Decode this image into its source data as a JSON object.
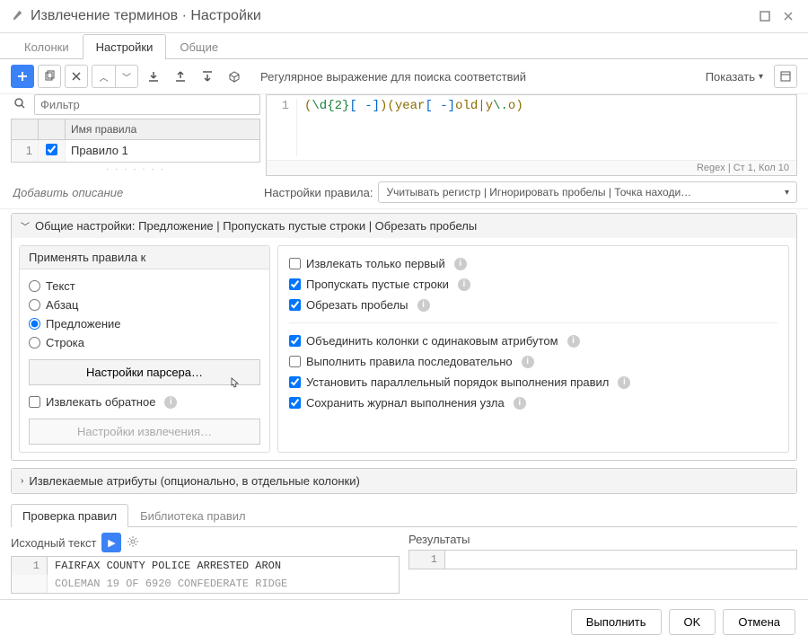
{
  "window": {
    "title": "Извлечение терминов · Настройки"
  },
  "tabs": {
    "columns": "Колонки",
    "settings": "Настройки",
    "general": "Общие"
  },
  "toolbar": {
    "regex_label": "Регулярное выражение для поиска соответствий",
    "show_label": "Показать"
  },
  "filter": {
    "placeholder": "Фильтр"
  },
  "rules_table": {
    "header_name": "Имя правила",
    "rows": [
      {
        "num": "1",
        "checked": true,
        "name": "Правило 1"
      }
    ]
  },
  "code": {
    "line_num": "1",
    "regex_display": "(\\d{2}[ -])(year[ -]old|y\\.o)",
    "status": "Regex | Ст 1, Кол 10"
  },
  "desc": {
    "placeholder": "Добавить описание",
    "rule_settings_label": "Настройки правила:",
    "rule_settings_items": "Учитывать регистр | Игнорировать пробелы | Точка находи…"
  },
  "general_settings": {
    "header": "Общие настройки: Предложение | Пропускать пустые строки | Обрезать пробелы",
    "apply_to_label": "Применять правила к",
    "radios": {
      "text": "Текст",
      "paragraph": "Абзац",
      "sentence": "Предложение",
      "line": "Строка"
    },
    "parser_btn": "Настройки парсера…",
    "extract_inverse": "Извлекать обратное",
    "extract_settings_btn": "Настройки извлечения…",
    "checks": {
      "first_only": "Извлекать только первый",
      "skip_empty": "Пропускать пустые строки",
      "trim": "Обрезать пробелы",
      "merge_cols": "Объединить колонки с одинаковым атрибутом",
      "sequential": "Выполнить правила последовательно",
      "parallel": "Установить параллельный порядок выполнения правил",
      "save_log": "Сохранить журнал выполнения узла"
    }
  },
  "extracted_attrs": {
    "header": "Извлекаемые атрибуты (опционально, в отдельные колонки)"
  },
  "bottom_tabs": {
    "check": "Проверка правил",
    "library": "Библиотека правил"
  },
  "preview": {
    "source_label": "Исходный текст",
    "results_label": "Результаты",
    "source_rows": [
      {
        "num": "1",
        "text": "FAIRFAX COUNTY POLICE ARRESTED ARON"
      },
      {
        "num": "",
        "text": "COLEMAN  19  OF 6920 CONFEDERATE RIDGE"
      }
    ],
    "result_rows": [
      {
        "num": "1",
        "text": ""
      }
    ]
  },
  "footer": {
    "run": "Выполнить",
    "ok": "OK",
    "cancel": "Отмена"
  }
}
